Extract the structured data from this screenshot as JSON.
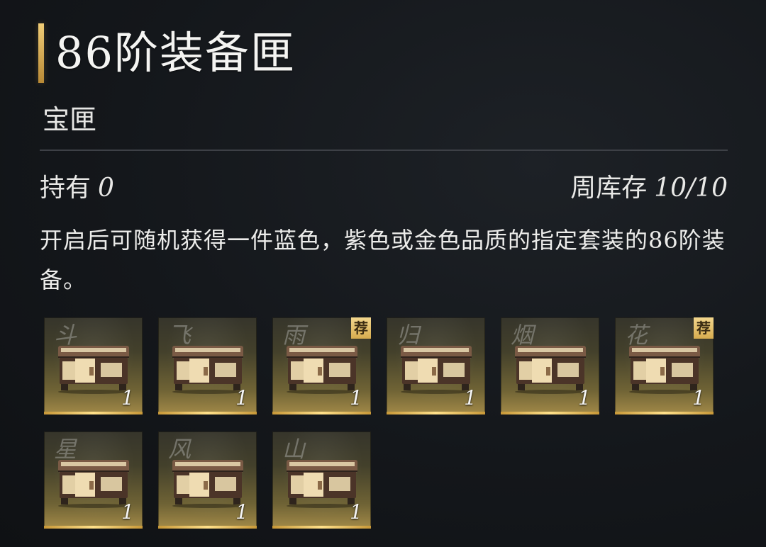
{
  "item": {
    "title": "86阶装备匣",
    "subtitle": "宝匣",
    "owned_label": "持有",
    "owned_value": "0",
    "weekly_label": "周库存",
    "weekly_value": "10/10",
    "description": "开启后可随机获得一件蓝色，紫色或金色品质的指定套装的86阶装备。"
  },
  "rewards": [
    {
      "glyph": "斗",
      "badge": "",
      "qty": "1"
    },
    {
      "glyph": "飞",
      "badge": "",
      "qty": "1"
    },
    {
      "glyph": "雨",
      "badge": "荐",
      "qty": "1"
    },
    {
      "glyph": "归",
      "badge": "",
      "qty": "1"
    },
    {
      "glyph": "烟",
      "badge": "",
      "qty": "1"
    },
    {
      "glyph": "花",
      "badge": "荐",
      "qty": "1"
    },
    {
      "glyph": "星",
      "badge": "",
      "qty": "1"
    },
    {
      "glyph": "风",
      "badge": "",
      "qty": "1"
    },
    {
      "glyph": "山",
      "badge": "",
      "qty": "1"
    }
  ],
  "colors": {
    "accent": "#d6a748",
    "background": "#14171b",
    "text": "#ececea"
  }
}
